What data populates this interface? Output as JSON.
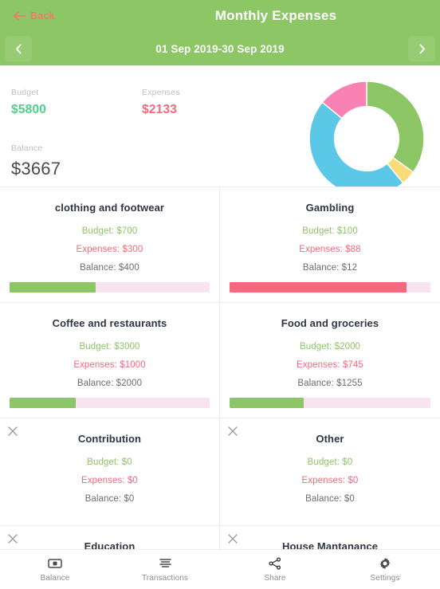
{
  "header": {
    "back_label": "Back",
    "back_icon": "arrow-left-icon",
    "title": "Monthly Expenses",
    "brand_green": "#8cc665",
    "back_color": "#f4796b"
  },
  "date_nav": {
    "prev_icon": "chevron-left-icon",
    "next_icon": "chevron-right-icon",
    "range": "01 Sep 2019-30 Sep 2019"
  },
  "summary": {
    "budget_label": "Budget",
    "budget_value": "$5800",
    "expenses_label": "Expenses",
    "expenses_value": "$2133",
    "balance_label": "Balance",
    "balance_value": "$3667",
    "budget_color": "#4fd18b",
    "expenses_color": "#f4697c",
    "balance_color": "#4a4a4a"
  },
  "chart_data": {
    "type": "pie",
    "title": "",
    "subtype": "donut",
    "categories": [
      "Food and groceries",
      "Gambling",
      "Coffee and restaurants",
      "clothing and footwear"
    ],
    "values": [
      745,
      88,
      1000,
      300
    ],
    "percentages": [
      34.9,
      4.1,
      46.9,
      14.1
    ],
    "colors": [
      "#8cc665",
      "#fcdc78",
      "#5bc8e8",
      "#f981b4"
    ],
    "legend": "none",
    "start_angle": 0,
    "inner_radius_ratio": 0.56,
    "total": 2133
  },
  "cards": [
    {
      "name": "clothing and footwear",
      "budget": "Budget: $700",
      "expenses": "Expenses: $300",
      "balance": "Balance: $400",
      "bar_percent": 43,
      "bar_color": "#8cc665",
      "has_bar": true,
      "closable": false
    },
    {
      "name": "Gambling",
      "budget": "Budget: $100",
      "expenses": "Expenses: $88",
      "balance": "Balance: $12",
      "bar_percent": 88,
      "bar_color": "#f4697c",
      "has_bar": true,
      "closable": false
    },
    {
      "name": "Coffee and restaurants",
      "budget": "Budget: $3000",
      "expenses": "Expenses: $1000",
      "balance": "Balance: $2000",
      "bar_percent": 33,
      "bar_color": "#8cc665",
      "has_bar": true,
      "closable": false
    },
    {
      "name": "Food and groceries",
      "budget": "Budget: $2000",
      "expenses": "Expenses: $745",
      "balance": "Balance: $1255",
      "bar_percent": 37,
      "bar_color": "#8cc665",
      "has_bar": true,
      "closable": false
    },
    {
      "name": "Contribution",
      "budget": "Budget: $0",
      "expenses": "Expenses: $0",
      "balance": "Balance: $0",
      "bar_percent": 0,
      "bar_color": "#8cc665",
      "has_bar": false,
      "closable": true,
      "close_icon": "close-icon"
    },
    {
      "name": "Other",
      "budget": "Budget: $0",
      "expenses": "Expenses: $0",
      "balance": "Balance: $0",
      "bar_percent": 0,
      "bar_color": "#8cc665",
      "has_bar": false,
      "closable": true,
      "close_icon": "close-icon"
    },
    {
      "name": "Education",
      "budget": "",
      "expenses": "",
      "balance": "",
      "bar_percent": 0,
      "bar_color": "#8cc665",
      "has_bar": false,
      "closable": true,
      "close_icon": "close-icon"
    },
    {
      "name": "House Mantanance",
      "budget": "",
      "expenses": "",
      "balance": "",
      "bar_percent": 0,
      "bar_color": "#8cc665",
      "has_bar": false,
      "closable": true,
      "close_icon": "close-icon"
    }
  ],
  "bottom_nav": [
    {
      "label": "Balance",
      "icon": "wallet-icon"
    },
    {
      "label": "Transactions",
      "icon": "list-lines-icon"
    },
    {
      "label": "Share",
      "icon": "share-icon"
    },
    {
      "label": "Settings",
      "icon": "gear-icon"
    }
  ]
}
